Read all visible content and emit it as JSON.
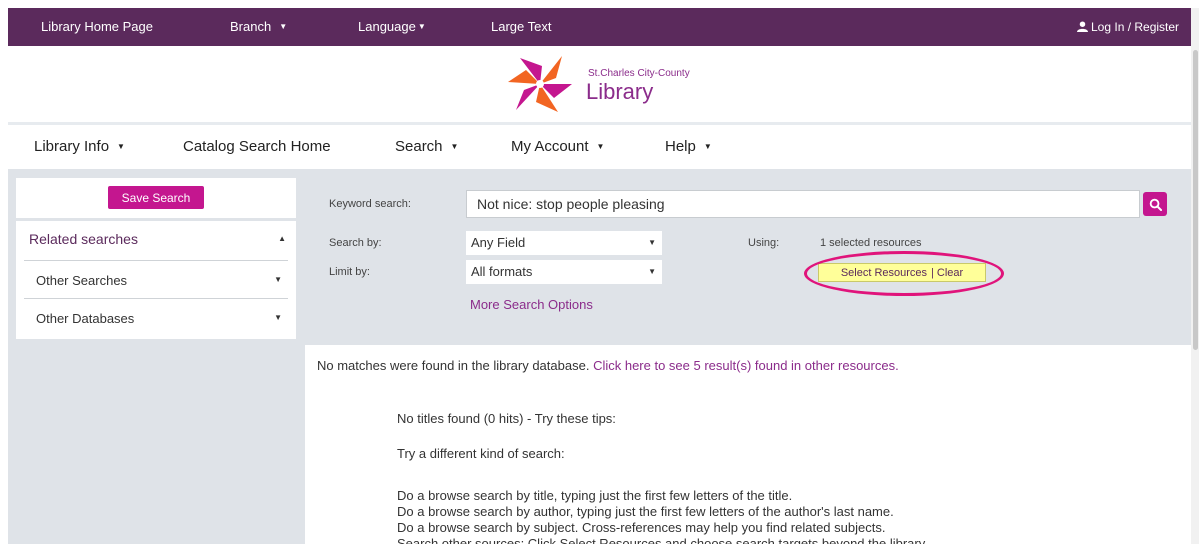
{
  "topbar": {
    "home": "Library Home Page",
    "branch": "Branch",
    "language": "Language",
    "large_text": "Large Text",
    "login": "Log In / Register"
  },
  "logo": {
    "subtitle": "St.Charles City-County",
    "title": "Library"
  },
  "nav": {
    "library_info": "Library Info",
    "catalog_home": "Catalog Search Home",
    "search": "Search",
    "my_account": "My Account",
    "help": "Help"
  },
  "sidebar": {
    "save_search": "Save Search",
    "related_searches": "Related searches",
    "items": [
      {
        "label": "Other Searches"
      },
      {
        "label": "Other Databases"
      }
    ]
  },
  "search_form": {
    "keyword_label": "Keyword search:",
    "keyword_value": "Not nice: stop people pleasing",
    "search_by_label": "Search by:",
    "search_by_value": "Any Field",
    "limit_by_label": "Limit by:",
    "limit_by_value": "All formats",
    "more_options": "More Search Options",
    "using_label": "Using:",
    "using_value": "1 selected resources",
    "select_resources": "Select Resources",
    "separator": "|",
    "clear": "Clear"
  },
  "results": {
    "no_match_text": "No matches were found in the library database.",
    "other_resources_link": "Click here to see 5 result(s) found in other resources.",
    "no_titles": "No titles found (0 hits) - Try these tips:",
    "try_different": "Try a different kind of search:",
    "tips": [
      "Do a browse search by title, typing just the first few letters of the title.",
      "Do a browse search by author, typing just the first few letters of the author's last name.",
      "Do a browse search by subject. Cross-references may help you find related subjects.",
      "Search other sources: Click Select Resources and choose search targets beyond the library."
    ]
  },
  "colors": {
    "topbar": "#5b2a5c",
    "accent": "#c4168f",
    "link": "#8b2c8b",
    "highlight_ring": "#e0147b",
    "resource_button": "#ffff99"
  }
}
